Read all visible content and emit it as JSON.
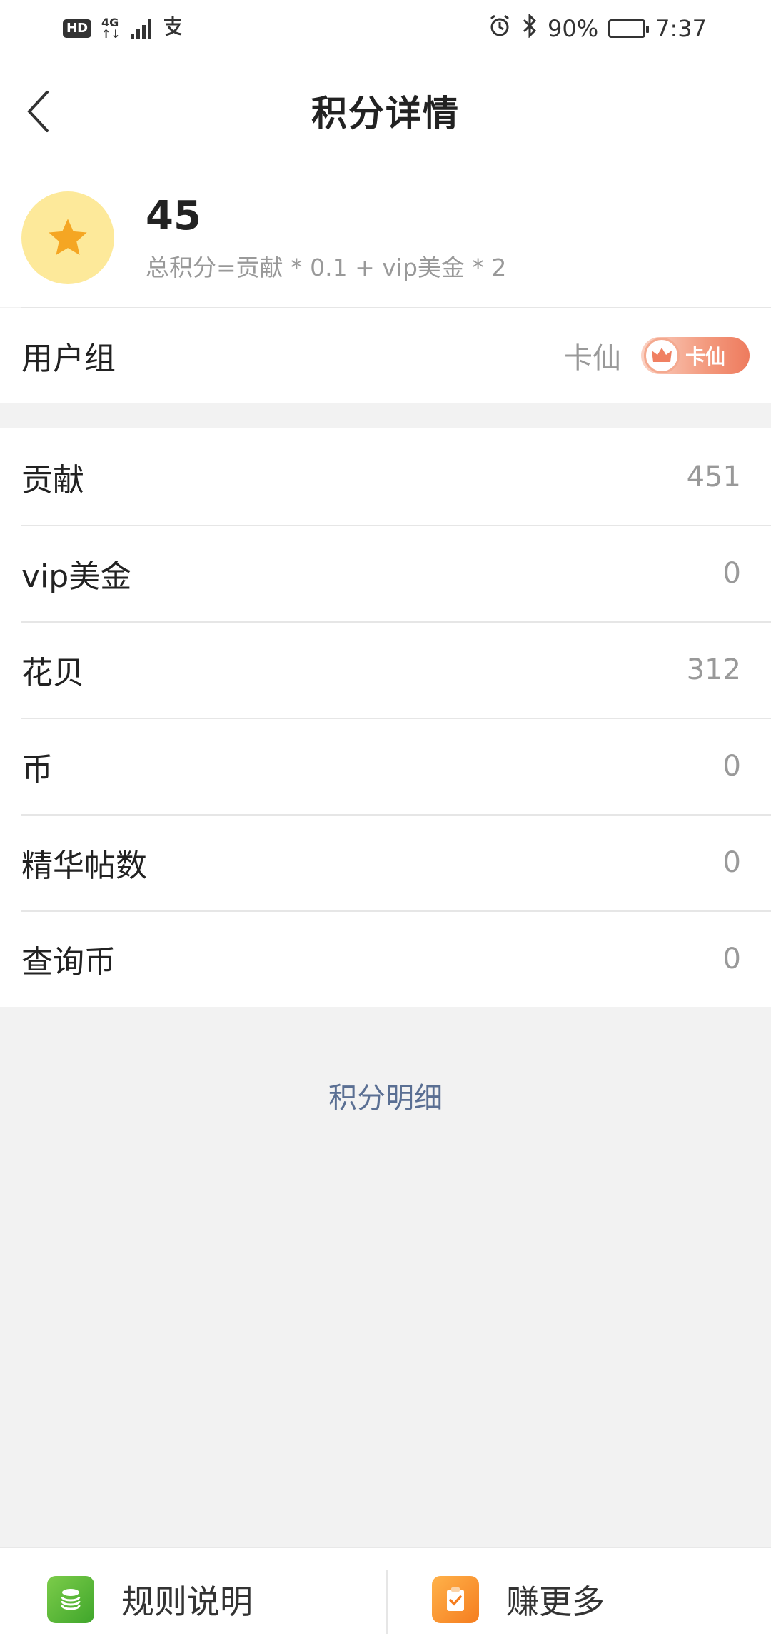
{
  "status_bar": {
    "net_top": "4G",
    "net_bottom": "↑↓",
    "battery_percent": "90%",
    "battery_level": 0.9,
    "time": "7:37"
  },
  "header": {
    "title": "积分详情"
  },
  "summary": {
    "total_points": "45",
    "formula": "总积分=贡献 * 0.1 + vip美金 * 2"
  },
  "user_group": {
    "label": "用户组",
    "value": "卡仙",
    "badge_text": "卡仙"
  },
  "stats": [
    {
      "label": "贡献",
      "value": "451"
    },
    {
      "label": "vip美金",
      "value": "0"
    },
    {
      "label": "花贝",
      "value": "312"
    },
    {
      "label": "币",
      "value": "0"
    },
    {
      "label": "精华帖数",
      "value": "0"
    },
    {
      "label": "查询币",
      "value": "0"
    }
  ],
  "detail_link": "积分明细",
  "bottom_bar": {
    "rules_label": "规则说明",
    "earn_label": "赚更多"
  },
  "colors": {
    "link": "#5a6f93",
    "star": "#f5a623",
    "badge_bg": "#fde99a"
  }
}
